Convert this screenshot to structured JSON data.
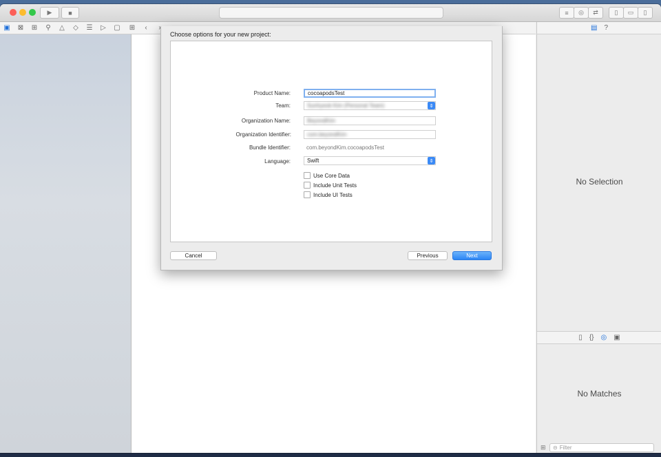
{
  "window": {
    "traffic_lights": [
      "#fc5f57",
      "#fdbc2e",
      "#34c84a"
    ],
    "nav_icons": [
      "folder-icon",
      "source-control-icon",
      "hierarchy-icon",
      "search-icon",
      "warning-icon",
      "test-icon",
      "debug-icon",
      "breakpoint-icon",
      "report-icon"
    ]
  },
  "sheet": {
    "title": "Choose options for your new project:",
    "fields": {
      "product_name": {
        "label": "Product Name:",
        "value": "cocoapodsTest"
      },
      "team": {
        "label": "Team:",
        "value": "Sunhyeok Kim (Personal Team)"
      },
      "organization_name": {
        "label": "Organization Name:",
        "value": "BeyondKim"
      },
      "organization_identifier": {
        "label": "Organization Identifier:",
        "value": "com.beyondKim"
      },
      "bundle_identifier": {
        "label": "Bundle Identifier:",
        "value": "com.beyondKim.cocoapodsTest"
      },
      "language": {
        "label": "Language:",
        "value": "Swift"
      }
    },
    "checkboxes": [
      {
        "label": "Use Core Data",
        "checked": false
      },
      {
        "label": "Include Unit Tests",
        "checked": false
      },
      {
        "label": "Include UI Tests",
        "checked": false
      }
    ],
    "buttons": {
      "cancel": "Cancel",
      "previous": "Previous",
      "next": "Next"
    }
  },
  "inspector": {
    "no_selection": "No Selection",
    "no_matches": "No Matches",
    "filter_placeholder": "Filter"
  },
  "colors": {
    "accent": "#2c86f5"
  }
}
